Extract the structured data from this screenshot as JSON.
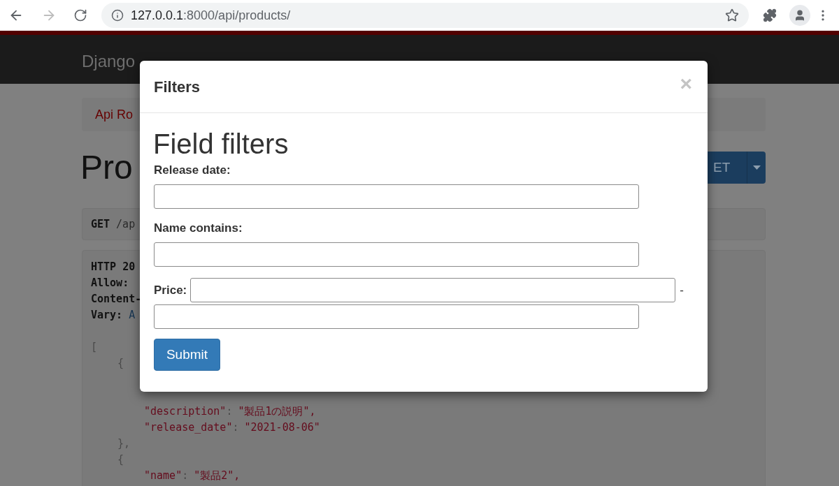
{
  "browser": {
    "url_host": "127.0.0.1",
    "url_path": ":8000/api/products/",
    "forward_disabled": true
  },
  "navbar": {
    "brand": "Django"
  },
  "breadcrumb": "Api Ro",
  "page_title": "Pro",
  "get_button": "ET",
  "request_line": {
    "method": "GET",
    "path": "/ap"
  },
  "response_headers": [
    {
      "name": "HTTP 20"
    },
    {
      "name": "Allow:"
    },
    {
      "name": "Content-"
    },
    {
      "name": "Vary:",
      "value": "A"
    }
  ],
  "response_body": [
    {
      "kind": "punct",
      "text": "[",
      "children": [
        {
          "kind": "punct",
          "text": "{",
          "children": [
            {
              "kind": "pair",
              "key": "\"description\"",
              "separator": ":",
              "value": "\"製品1の説明\","
            },
            {
              "kind": "pair",
              "key": "\"release_date\"",
              "separator": ":",
              "value": "\"2021-08-06\""
            }
          ]
        },
        {
          "kind": "punct",
          "text": "},"
        },
        {
          "kind": "punct",
          "text": "{",
          "children": [
            {
              "kind": "pair",
              "key": "\"name\"",
              "separator": ":",
              "value": "\"製品2\","
            }
          ]
        }
      ]
    }
  ],
  "modal": {
    "title": "Filters",
    "close": "×",
    "heading": "Field filters",
    "fields": [
      {
        "kind": "stacked",
        "label": "Release date:"
      },
      {
        "kind": "stacked",
        "label": "Name contains:"
      },
      {
        "kind": "range",
        "label": "Price:",
        "separator": "-"
      }
    ],
    "submit": "Submit"
  }
}
